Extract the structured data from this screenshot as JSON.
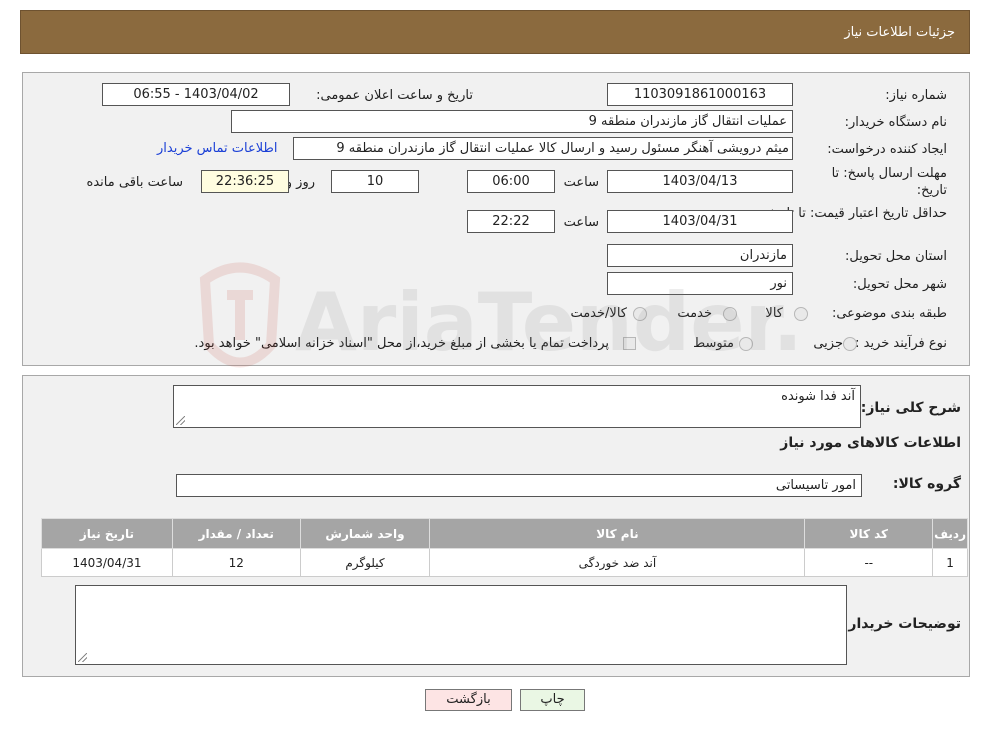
{
  "header": {
    "title": "جزئیات اطلاعات نیاز"
  },
  "form": {
    "need_number_label": "شماره نیاز:",
    "need_number": "1103091861000163",
    "announce_label": "تاریخ و ساعت اعلان عمومی:",
    "announce_value": "1403/04/02 - 06:55",
    "buyer_org_label": "نام دستگاه خریدار:",
    "buyer_org": "عملیات انتقال گاز مازندران منطقه 9",
    "creator_label": "ایجاد کننده درخواست:",
    "creator": "میثم درویشی آهنگر مسئول رسید و ارسال کالا عملیات انتقال گاز مازندران منطقه 9",
    "contact_link": "اطلاعات تماس خریدار",
    "reply_deadline_label": "مهلت ارسال پاسخ: تا تاریخ:",
    "reply_date": "1403/04/13",
    "time_label": "ساعت",
    "reply_time": "06:00",
    "days_value": "10",
    "days_label": "روز و",
    "remaining_time": "22:36:25",
    "remaining_label": "ساعت باقی مانده",
    "min_validity_label": "حداقل تاریخ اعتبار قیمت: تا تاریخ:",
    "validity_date": "1403/04/31",
    "validity_time": "22:22",
    "province_label": "استان محل تحویل:",
    "province": "مازندران",
    "city_label": "شهر محل تحویل:",
    "city": "نور",
    "category_label": "طبقه بندی موضوعی:",
    "category_options": [
      "کالا",
      "خدمت",
      "کالا/خدمت"
    ],
    "process_label": "نوع فرآیند خرید :",
    "process_options": [
      "جزیی",
      "متوسط"
    ],
    "process_note": "پرداخت تمام یا بخشی از مبلغ خرید،از محل \"اسناد خزانه اسلامی\" خواهد بود."
  },
  "details": {
    "summary_label": "شرح کلی نیاز:",
    "summary_value": "آند فدا شونده",
    "items_title": "اطلاعات کالاهای مورد نیاز",
    "group_label": "گروه کالا:",
    "group_value": "امور تاسیساتی",
    "table": {
      "headers": [
        "ردیف",
        "کد کالا",
        "نام کالا",
        "واحد شمارش",
        "تعداد / مقدار",
        "تاریخ نیاز"
      ],
      "rows": [
        [
          "1",
          "--",
          "آند ضد خوردگی",
          "کیلوگرم",
          "12",
          "1403/04/31"
        ]
      ]
    },
    "buyer_notes_label": "توضیحات خریدار:",
    "buyer_notes_value": ""
  },
  "buttons": {
    "print": "چاپ",
    "back": "بازگشت"
  },
  "watermark": {
    "text": "AriaTender.neT"
  },
  "colors": {
    "header_bg": "#8b6a3e",
    "table_header_bg": "#a5a5a5",
    "back_btn_bg": "#fde4e4",
    "print_btn_bg": "#eaf7e4",
    "link": "#1a3fd6"
  }
}
